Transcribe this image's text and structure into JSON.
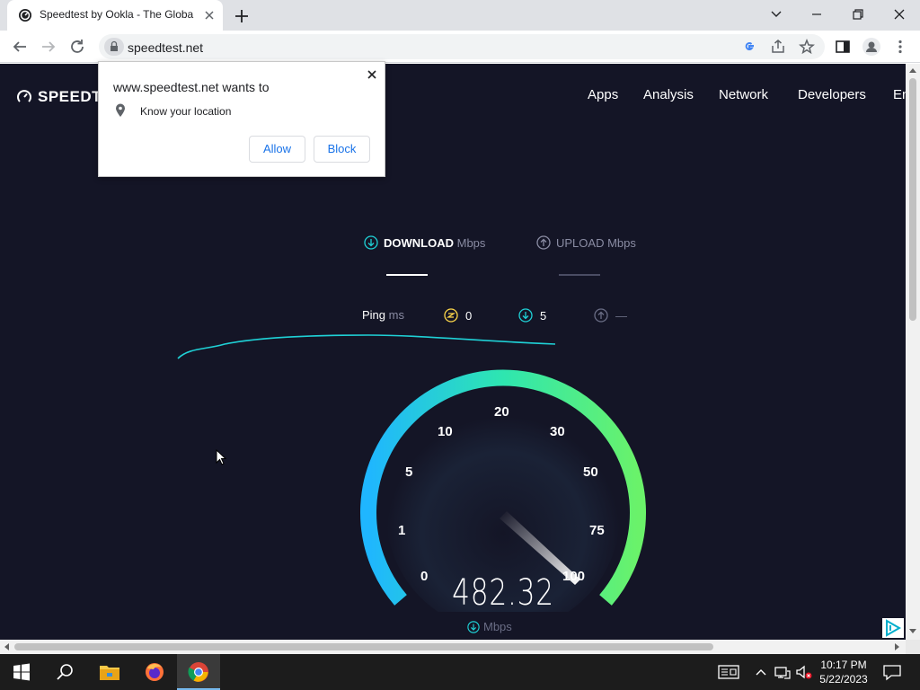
{
  "browser": {
    "tab_title": "Speedtest by Ookla - The Global",
    "url": "speedtest.net"
  },
  "site": {
    "logo_text": "SPEEDT",
    "nav": [
      "Apps",
      "Analysis",
      "Network",
      "Developers",
      "En"
    ]
  },
  "test": {
    "download_label": "DOWNLOAD",
    "download_unit": "Mbps",
    "upload_label": "UPLOAD",
    "upload_unit": "Mbps",
    "ping_label": "Ping",
    "ping_unit": "ms",
    "ping_value": "0",
    "down_latency": "5",
    "up_latency": "—",
    "speed": "482.32",
    "speed_unit": "Mbps",
    "gauge_labels": [
      "0",
      "1",
      "5",
      "10",
      "20",
      "30",
      "50",
      "75",
      "100"
    ]
  },
  "popup": {
    "title": "www.speedtest.net wants to",
    "permission": "Know your location",
    "allow_label": "Allow",
    "block_label": "Block"
  },
  "taskbar": {
    "time": "10:17 PM",
    "date": "5/22/2023"
  },
  "colors": {
    "page_bg": "#141526",
    "accent_cyan": "#1fd1d6",
    "accent_green": "#6af26a",
    "gauge_blue": "#1fb6ff"
  }
}
